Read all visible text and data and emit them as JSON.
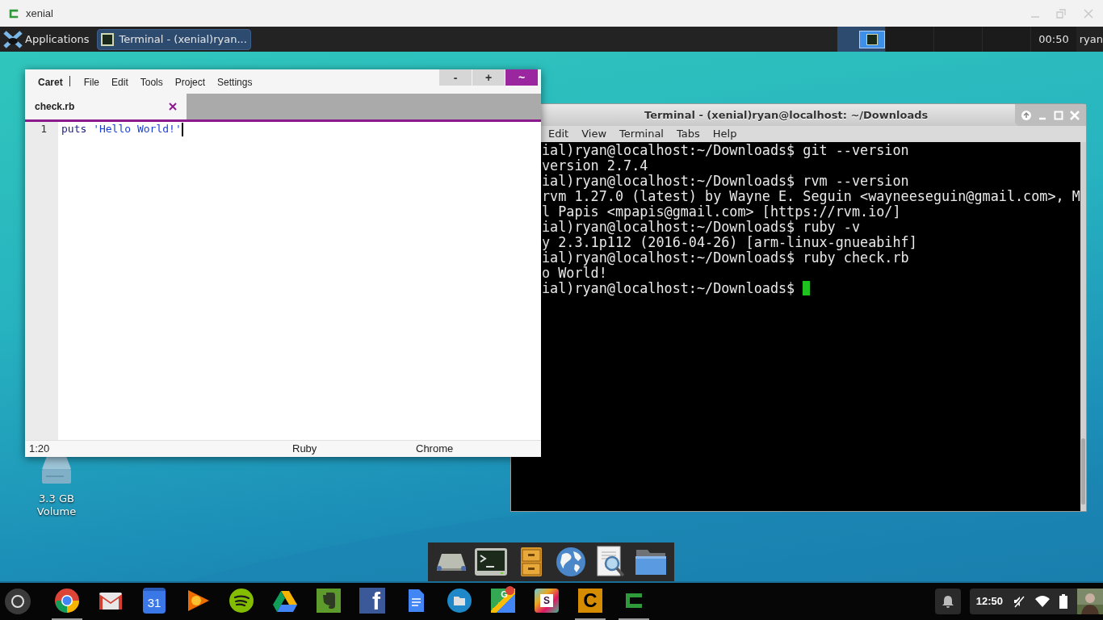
{
  "window": {
    "title": "xenial"
  },
  "top_panel": {
    "menu_label": "Applications",
    "tasks": [
      {
        "label": "Terminal - (xenial)ryan...",
        "selected": true
      }
    ],
    "workspaces": [
      {
        "selected": true
      },
      {
        "selected": false
      },
      {
        "selected": false
      },
      {
        "selected": false
      }
    ],
    "clock": "00:50",
    "user": "ryan"
  },
  "caret": {
    "app_name": "Caret",
    "menu": [
      "File",
      "Edit",
      "Tools",
      "Project",
      "Settings"
    ],
    "buttons": [
      {
        "label": "-",
        "kind": "plain"
      },
      {
        "label": "+",
        "kind": "plain"
      },
      {
        "label": "~",
        "kind": "accent"
      }
    ],
    "tabs": [
      {
        "label": "check.rb",
        "selected": true
      }
    ],
    "lines": [
      {
        "number": "1",
        "tokens": [
          {
            "text": "puts",
            "kind": "keyword"
          },
          {
            "text": " 'Hello World!'",
            "kind": "string"
          }
        ]
      }
    ],
    "status": {
      "position": "1:20",
      "language": "Ruby",
      "theme": "Chrome"
    }
  },
  "terminal": {
    "title": "Terminal - (xenial)ryan@localhost: ~/Downloads",
    "menu": [
      "Edit",
      "View",
      "Terminal",
      "Tabs",
      "Help"
    ],
    "lines": [
      "ial)ryan@localhost:~/Downloads$ git --version",
      "version 2.7.4",
      "ial)ryan@localhost:~/Downloads$ rvm --version",
      "rvm 1.27.0 (latest) by Wayne E. Seguin <wayneeseguin@gmail.com>, M",
      "l Papis <mpapis@gmail.com> [https://rvm.io/]",
      "ial)ryan@localhost:~/Downloads$ ruby -v",
      "y 2.3.1p112 (2016-04-26) [arm-linux-gnueabihf]",
      "ial)ryan@localhost:~/Downloads$ ruby check.rb",
      "o World!",
      "ial)ryan@localhost:~/Downloads$ "
    ],
    "cursor": true
  },
  "desktop_icons": [
    {
      "label": "3.3 GB Volume",
      "kind": "drive"
    }
  ],
  "dock": [
    {
      "kind": "drive"
    },
    {
      "kind": "terminal"
    },
    {
      "kind": "cabinet"
    },
    {
      "kind": "globe"
    },
    {
      "kind": "viewer"
    },
    {
      "kind": "folder"
    }
  ],
  "shelf": {
    "apps": [
      {
        "kind": "chrome",
        "running": true
      },
      {
        "kind": "gmail",
        "running": false
      },
      {
        "kind": "calendar",
        "glyph": "31",
        "running": false
      },
      {
        "kind": "music",
        "running": false
      },
      {
        "kind": "spotify",
        "running": false
      },
      {
        "kind": "drive",
        "running": false
      },
      {
        "kind": "evernote",
        "running": false
      },
      {
        "kind": "facebook",
        "glyph": "f",
        "running": false
      },
      {
        "kind": "docs",
        "running": false
      },
      {
        "kind": "files",
        "running": false
      },
      {
        "kind": "maps",
        "glyph": "G",
        "running": false
      },
      {
        "kind": "slack",
        "glyph": "S",
        "running": false
      },
      {
        "kind": "caret",
        "glyph": "C",
        "running": true
      },
      {
        "kind": "crouton",
        "running": true
      }
    ],
    "clock": "12:50"
  }
}
